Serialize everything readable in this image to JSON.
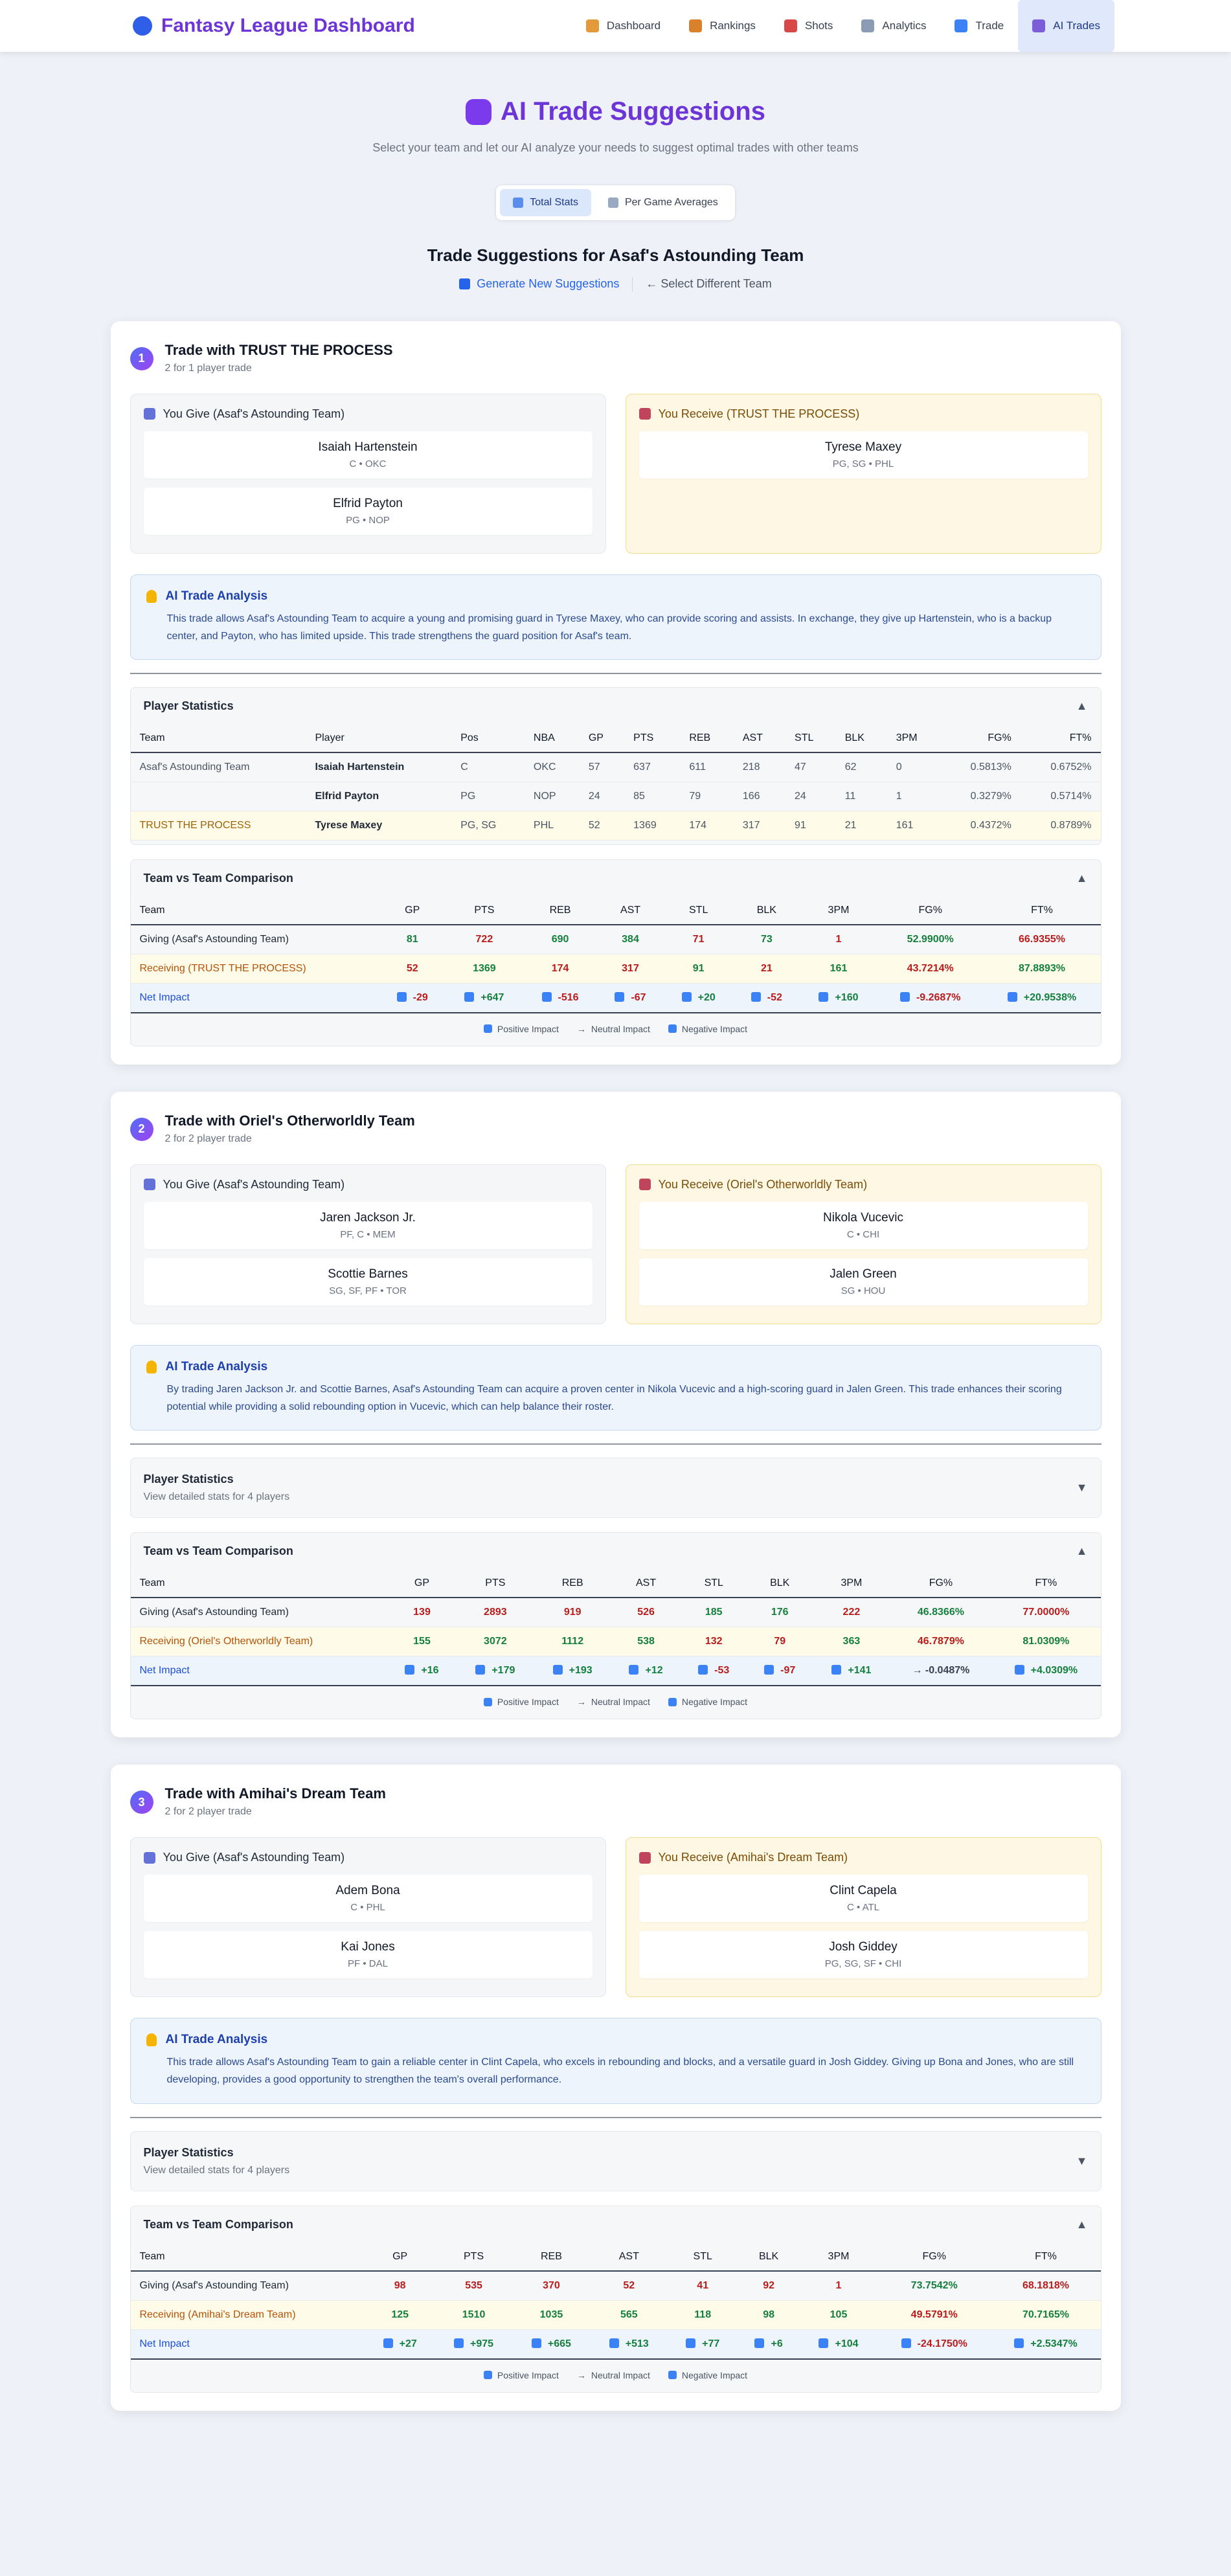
{
  "header": {
    "brand": "Fantasy League Dashboard",
    "nav": [
      {
        "label": "Dashboard",
        "icon": "chart-icon",
        "color": "#e29a3b"
      },
      {
        "label": "Rankings",
        "icon": "trophy-icon",
        "color": "#d9822b"
      },
      {
        "label": "Shots",
        "icon": "target-icon",
        "color": "#d94848"
      },
      {
        "label": "Analytics",
        "icon": "trend-icon",
        "color": "#8c9bb4"
      },
      {
        "label": "Trade",
        "icon": "trade-icon",
        "color": "#3b82f6"
      },
      {
        "label": "AI Trades",
        "icon": "robot-icon",
        "color": "#7c5fd8"
      }
    ]
  },
  "hero": {
    "title": "AI Trade Suggestions",
    "subtitle": "Select your team and let our AI analyze your needs to suggest optimal trades with other teams",
    "toggle": [
      "Total Stats",
      "Per Game Averages"
    ]
  },
  "results": {
    "title": "Trade Suggestions for Asaf's Astounding Team",
    "generate": "Generate New Suggestions",
    "back": "← Select Different Team"
  },
  "labels": {
    "analysis": "AI Trade Analysis",
    "player_stats": "Player Statistics",
    "comparison": "Team vs Team Comparison",
    "legend_pos": "Positive Impact",
    "legend_neu": "Neutral Impact",
    "legend_neg": "Negative Impact",
    "ps_cols": [
      "Team",
      "Player",
      "Pos",
      "NBA",
      "GP",
      "PTS",
      "REB",
      "AST",
      "STL",
      "BLK",
      "3PM",
      "FG%",
      "FT%"
    ],
    "cmp_cols": [
      "Team",
      "GP",
      "PTS",
      "REB",
      "AST",
      "STL",
      "BLK",
      "3PM",
      "FG%",
      "FT%"
    ]
  },
  "trades": [
    {
      "num": "1",
      "title": "Trade with TRUST THE PROCESS",
      "sub": "2 for 1 player trade",
      "give_head": "You Give (Asaf's Astounding Team)",
      "recv_head": "You Receive (TRUST THE PROCESS)",
      "give": [
        {
          "name": "Isaiah Hartenstein",
          "meta": "C • OKC"
        },
        {
          "name": "Elfrid Payton",
          "meta": "PG • NOP"
        }
      ],
      "recv": [
        {
          "name": "Tyrese Maxey",
          "meta": "PG, SG • PHL"
        }
      ],
      "analysis": "This trade allows Asaf's Astounding Team to acquire a young and promising guard in Tyrese Maxey, who can provide scoring and assists. In exchange, they give up Hartenstein, who is a backup center, and Payton, who has limited upside. This trade strengthens the guard position for Asaf's team.",
      "ps_expanded": true,
      "ps_sub": "",
      "ps_rows": [
        {
          "team": "Asaf's Astounding Team",
          "player": "Isaiah Hartenstein",
          "pos": "C",
          "nba": "OKC",
          "gp": "57",
          "pts": "637",
          "reb": "611",
          "ast": "218",
          "stl": "47",
          "blk": "62",
          "tpm": "0",
          "fg": "0.5813%",
          "ft": "0.6752%",
          "side": "give"
        },
        {
          "team": "",
          "player": "Elfrid Payton",
          "pos": "PG",
          "nba": "NOP",
          "gp": "24",
          "pts": "85",
          "reb": "79",
          "ast": "166",
          "stl": "24",
          "blk": "11",
          "tpm": "1",
          "fg": "0.3279%",
          "ft": "0.5714%",
          "side": "give"
        },
        {
          "team": "TRUST THE PROCESS",
          "player": "Tyrese Maxey",
          "pos": "PG, SG",
          "nba": "PHL",
          "gp": "52",
          "pts": "1369",
          "reb": "174",
          "ast": "317",
          "stl": "91",
          "blk": "21",
          "tpm": "161",
          "fg": "0.4372%",
          "ft": "0.8789%",
          "side": "recv"
        }
      ],
      "cmp": {
        "give_label": "Giving (Asaf's Astounding Team)",
        "recv_label": "Receiving (TRUST THE PROCESS)",
        "net_label": "Net Impact",
        "give": [
          [
            "81",
            "g"
          ],
          [
            "722",
            "r"
          ],
          [
            "690",
            "g"
          ],
          [
            "384",
            "g"
          ],
          [
            "71",
            "r"
          ],
          [
            "73",
            "g"
          ],
          [
            "1",
            "r"
          ],
          [
            "52.9900%",
            "g"
          ],
          [
            "66.9355%",
            "r"
          ]
        ],
        "recv": [
          [
            "52",
            "r"
          ],
          [
            "1369",
            "g"
          ],
          [
            "174",
            "r"
          ],
          [
            "317",
            "r"
          ],
          [
            "91",
            "g"
          ],
          [
            "21",
            "r"
          ],
          [
            "161",
            "g"
          ],
          [
            "43.7214%",
            "r"
          ],
          [
            "87.8893%",
            "g"
          ]
        ],
        "net": [
          [
            "-29",
            "r",
            "neg"
          ],
          [
            "+647",
            "g",
            "pos"
          ],
          [
            "-516",
            "r",
            "neg"
          ],
          [
            "-67",
            "r",
            "neg"
          ],
          [
            "+20",
            "g",
            "pos"
          ],
          [
            "-52",
            "r",
            "neg"
          ],
          [
            "+160",
            "g",
            "pos"
          ],
          [
            "-9.2687%",
            "r",
            "neg"
          ],
          [
            "+20.9538%",
            "g",
            "pos"
          ]
        ]
      }
    },
    {
      "num": "2",
      "title": "Trade with Oriel's Otherworldly Team",
      "sub": "2 for 2 player trade",
      "give_head": "You Give (Asaf's Astounding Team)",
      "recv_head": "You Receive (Oriel's Otherworldly Team)",
      "give": [
        {
          "name": "Jaren Jackson Jr.",
          "meta": "PF, C • MEM"
        },
        {
          "name": "Scottie Barnes",
          "meta": "SG, SF, PF • TOR"
        }
      ],
      "recv": [
        {
          "name": "Nikola Vucevic",
          "meta": "C • CHI"
        },
        {
          "name": "Jalen Green",
          "meta": "SG • HOU"
        }
      ],
      "analysis": "By trading Jaren Jackson Jr. and Scottie Barnes, Asaf's Astounding Team can acquire a proven center in Nikola Vucevic and a high-scoring guard in Jalen Green. This trade enhances their scoring potential while providing a solid rebounding option in Vucevic, which can help balance their roster.",
      "ps_expanded": false,
      "ps_sub": "View detailed stats for 4 players",
      "ps_rows": [],
      "cmp": {
        "give_label": "Giving (Asaf's Astounding Team)",
        "recv_label": "Receiving (Oriel's Otherworldly Team)",
        "net_label": "Net Impact",
        "give": [
          [
            "139",
            "r"
          ],
          [
            "2893",
            "r"
          ],
          [
            "919",
            "r"
          ],
          [
            "526",
            "r"
          ],
          [
            "185",
            "g"
          ],
          [
            "176",
            "g"
          ],
          [
            "222",
            "r"
          ],
          [
            "46.8366%",
            "g"
          ],
          [
            "77.0000%",
            "r"
          ]
        ],
        "recv": [
          [
            "155",
            "g"
          ],
          [
            "3072",
            "g"
          ],
          [
            "1112",
            "g"
          ],
          [
            "538",
            "g"
          ],
          [
            "132",
            "r"
          ],
          [
            "79",
            "r"
          ],
          [
            "363",
            "g"
          ],
          [
            "46.7879%",
            "r"
          ],
          [
            "81.0309%",
            "g"
          ]
        ],
        "net": [
          [
            "+16",
            "g",
            "pos"
          ],
          [
            "+179",
            "g",
            "pos"
          ],
          [
            "+193",
            "g",
            "pos"
          ],
          [
            "+12",
            "g",
            "pos"
          ],
          [
            "-53",
            "r",
            "neg"
          ],
          [
            "-97",
            "r",
            "neg"
          ],
          [
            "+141",
            "g",
            "pos"
          ],
          [
            "→ -0.0487%",
            "n",
            "neu"
          ],
          [
            "+4.0309%",
            "g",
            "pos"
          ]
        ]
      }
    },
    {
      "num": "3",
      "title": "Trade with Amihai's Dream Team",
      "sub": "2 for 2 player trade",
      "give_head": "You Give (Asaf's Astounding Team)",
      "recv_head": "You Receive (Amihai's Dream Team)",
      "give": [
        {
          "name": "Adem Bona",
          "meta": "C • PHL"
        },
        {
          "name": "Kai Jones",
          "meta": "PF • DAL"
        }
      ],
      "recv": [
        {
          "name": "Clint Capela",
          "meta": "C • ATL"
        },
        {
          "name": "Josh Giddey",
          "meta": "PG, SG, SF • CHI"
        }
      ],
      "analysis": "This trade allows Asaf's Astounding Team to gain a reliable center in Clint Capela, who excels in rebounding and blocks, and a versatile guard in Josh Giddey. Giving up Bona and Jones, who are still developing, provides a good opportunity to strengthen the team's overall performance.",
      "ps_expanded": false,
      "ps_sub": "View detailed stats for 4 players",
      "ps_rows": [],
      "cmp": {
        "give_label": "Giving (Asaf's Astounding Team)",
        "recv_label": "Receiving (Amihai's Dream Team)",
        "net_label": "Net Impact",
        "give": [
          [
            "98",
            "r"
          ],
          [
            "535",
            "r"
          ],
          [
            "370",
            "r"
          ],
          [
            "52",
            "r"
          ],
          [
            "41",
            "r"
          ],
          [
            "92",
            "r"
          ],
          [
            "1",
            "r"
          ],
          [
            "73.7542%",
            "g"
          ],
          [
            "68.1818%",
            "r"
          ]
        ],
        "recv": [
          [
            "125",
            "g"
          ],
          [
            "1510",
            "g"
          ],
          [
            "1035",
            "g"
          ],
          [
            "565",
            "g"
          ],
          [
            "118",
            "g"
          ],
          [
            "98",
            "g"
          ],
          [
            "105",
            "g"
          ],
          [
            "49.5791%",
            "r"
          ],
          [
            "70.7165%",
            "g"
          ]
        ],
        "net": [
          [
            "+27",
            "g",
            "pos"
          ],
          [
            "+975",
            "g",
            "pos"
          ],
          [
            "+665",
            "g",
            "pos"
          ],
          [
            "+513",
            "g",
            "pos"
          ],
          [
            "+77",
            "g",
            "pos"
          ],
          [
            "+6",
            "g",
            "pos"
          ],
          [
            "+104",
            "g",
            "pos"
          ],
          [
            "-24.1750%",
            "r",
            "neg"
          ],
          [
            "+2.5347%",
            "g",
            "pos"
          ]
        ]
      }
    }
  ]
}
